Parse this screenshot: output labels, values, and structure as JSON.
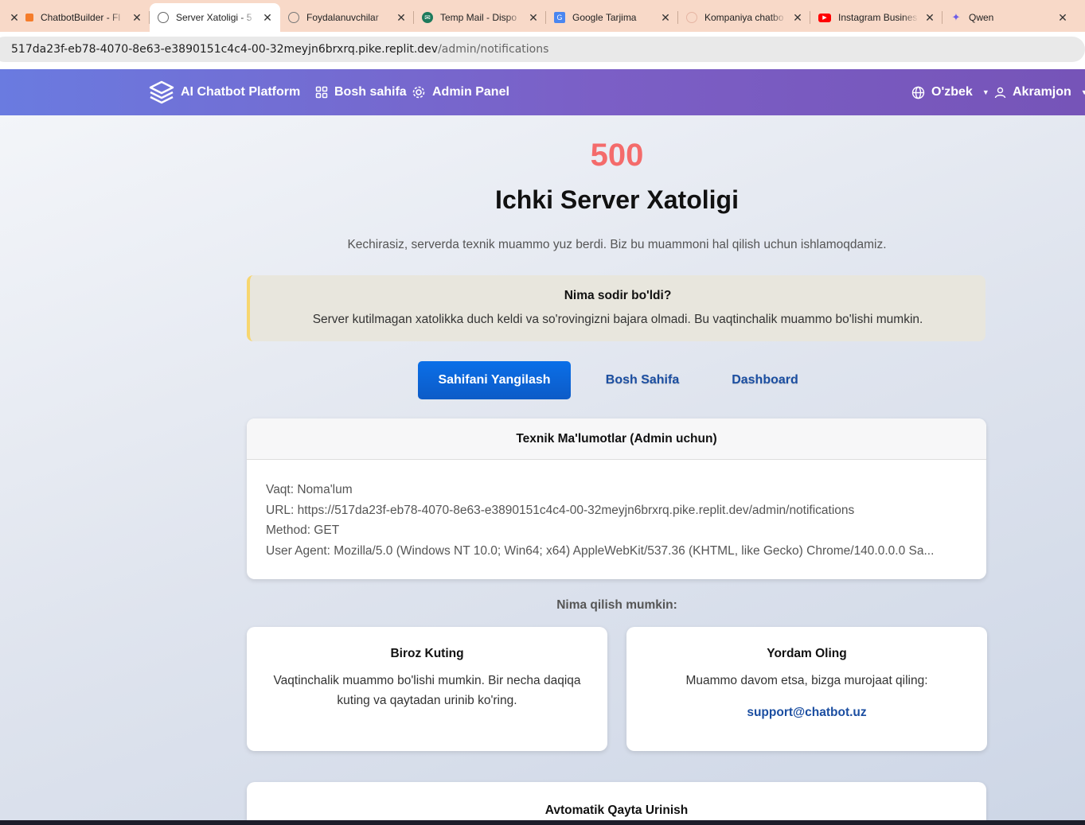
{
  "browser": {
    "tabs": [
      {
        "title": "ChatbotBuilder - Fl",
        "favicon": "orange-blocks-icon",
        "active": false
      },
      {
        "title": "Server Xatoligi - 5",
        "favicon": "globe-icon",
        "active": true
      },
      {
        "title": "Foydalanuvchilar",
        "favicon": "globe-icon",
        "active": false
      },
      {
        "title": "Temp Mail - Dispo",
        "favicon": "temp-mail-icon",
        "active": false
      },
      {
        "title": "Google Tarjima",
        "favicon": "google-translate-icon",
        "active": false
      },
      {
        "title": "Kompaniya chatbo",
        "favicon": "openai-icon",
        "active": false
      },
      {
        "title": "Instagram Busines",
        "favicon": "youtube-icon",
        "active": false
      },
      {
        "title": "Qwen",
        "favicon": "qwen-icon",
        "active": false
      }
    ],
    "url_host": "517da23f-eb78-4070-8e63-e3890151c4c4-00-32meyjn6brxrq.pike.replit.dev",
    "url_path": "/admin/notifications"
  },
  "navbar": {
    "brand": "AI Chatbot Platform",
    "home": "Bosh sahifa",
    "admin": "Admin Panel",
    "language": "O'zbek",
    "user": "Akramjon"
  },
  "error": {
    "code": "500",
    "title": "Ichki Server Xatoligi",
    "lead": "Kechirasiz, serverda texnik muammo yuz berdi. Biz bu muammoni hal qilish uchun ishlamoqdamiz."
  },
  "alert": {
    "heading": "Nima sodir bo'ldi?",
    "text": "Server kutilmagan xatolikka duch keldi va so'rovingizni bajara olmadi. Bu vaqtinchalik muammo bo'lishi mumkin."
  },
  "actions": {
    "reload": "Sahifani Yangilash",
    "home": "Bosh Sahifa",
    "dashboard": "Dashboard"
  },
  "tech": {
    "heading": "Texnik Ma'lumotlar (Admin uchun)",
    "time": "Vaqt: Noma'lum",
    "url": "URL: https://517da23f-eb78-4070-8e63-e3890151c4c4-00-32meyjn6brxrq.pike.replit.dev/admin/notifications",
    "method": "Method: GET",
    "agent": "User Agent: Mozilla/5.0 (Windows NT 10.0; Win64; x64) AppleWebKit/537.36 (KHTML, like Gecko) Chrome/140.0.0.0 Sa..."
  },
  "help": {
    "heading": "Nima qilish mumkin:",
    "wait_title": "Biroz Kuting",
    "wait_text": "Vaqtinchalik muammo bo'lishi mumkin. Bir necha daqiqa kuting va qaytadan urinib ko'ring.",
    "support_title": "Yordam Oling",
    "support_text": "Muammo davom etsa, bizga murojaat qiling:",
    "support_email": "support@chatbot.uz"
  },
  "retry": {
    "heading": "Avtomatik Qayta Urinish"
  }
}
